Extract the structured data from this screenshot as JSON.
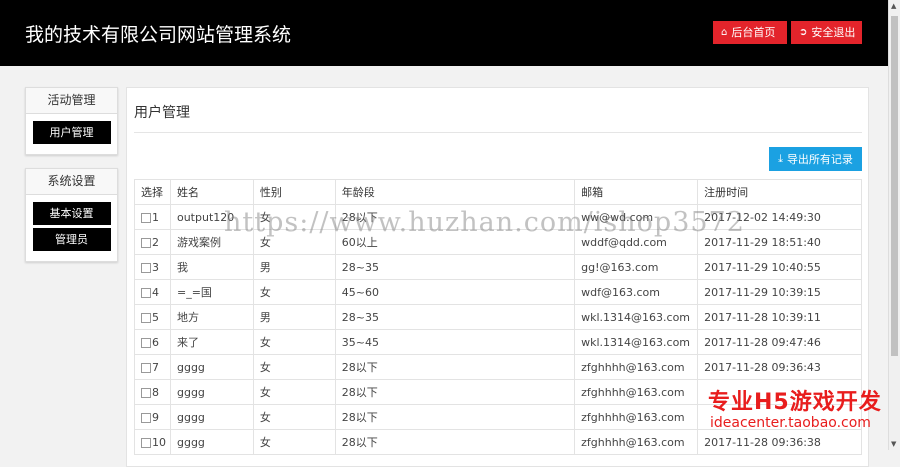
{
  "header": {
    "title": "我的技术有限公司网站管理系统",
    "home_label": "后台首页",
    "logout_label": "安全退出",
    "button_color": "#e3242b",
    "background": "#000000"
  },
  "sidebar": {
    "activity_title": "活动管理",
    "activity_items": [
      "用户管理"
    ],
    "system_title": "系统设置",
    "system_items": [
      "基本设置",
      "管理员"
    ]
  },
  "main": {
    "title": "用户管理",
    "export_label": "导出所有记录",
    "export_color": "#1ba1e2"
  },
  "table": {
    "headers": [
      "选择",
      "姓名",
      "性别",
      "年龄段",
      "邮箱",
      "注册时间"
    ],
    "rows": [
      {
        "id": "1",
        "name": "output120",
        "gender": "女",
        "age": "28以下",
        "email": "ww@wd.com",
        "time": "2017-12-02 14:49:30"
      },
      {
        "id": "2",
        "name": "游戏案例",
        "gender": "女",
        "age": "60以上",
        "email": "wddf@qdd.com",
        "time": "2017-11-29 18:51:40"
      },
      {
        "id": "3",
        "name": "我",
        "gender": "男",
        "age": "28~35",
        "email": "gg!@163.com",
        "time": "2017-11-29 10:40:55"
      },
      {
        "id": "4",
        "name": "=_=国",
        "gender": "女",
        "age": "45~60",
        "email": "wdf@163.com",
        "time": "2017-11-29 10:39:15"
      },
      {
        "id": "5",
        "name": "地方",
        "gender": "男",
        "age": "28~35",
        "email": "wkl.1314@163.com",
        "time": "2017-11-28 10:39:11"
      },
      {
        "id": "6",
        "name": "来了",
        "gender": "女",
        "age": "35~45",
        "email": "wkl.1314@163.com",
        "time": "2017-11-28 09:47:46"
      },
      {
        "id": "7",
        "name": "gggg",
        "gender": "女",
        "age": "28以下",
        "email": "zfghhhh@163.com",
        "time": "2017-11-28 09:36:43"
      },
      {
        "id": "8",
        "name": "gggg",
        "gender": "女",
        "age": "28以下",
        "email": "zfghhhh@163.com",
        "time": ""
      },
      {
        "id": "9",
        "name": "gggg",
        "gender": "女",
        "age": "28以下",
        "email": "zfghhhh@163.com",
        "time": ""
      },
      {
        "id": "10",
        "name": "gggg",
        "gender": "女",
        "age": "28以下",
        "email": "zfghhhh@163.com",
        "time": "2017-11-28 09:36:38"
      }
    ]
  },
  "watermark": "https://www.huzhan.com/ishop3572",
  "promo": {
    "title": "专业H5游戏开发",
    "subtitle": "ideacenter.taobao.com",
    "color": "#e81d1d"
  }
}
